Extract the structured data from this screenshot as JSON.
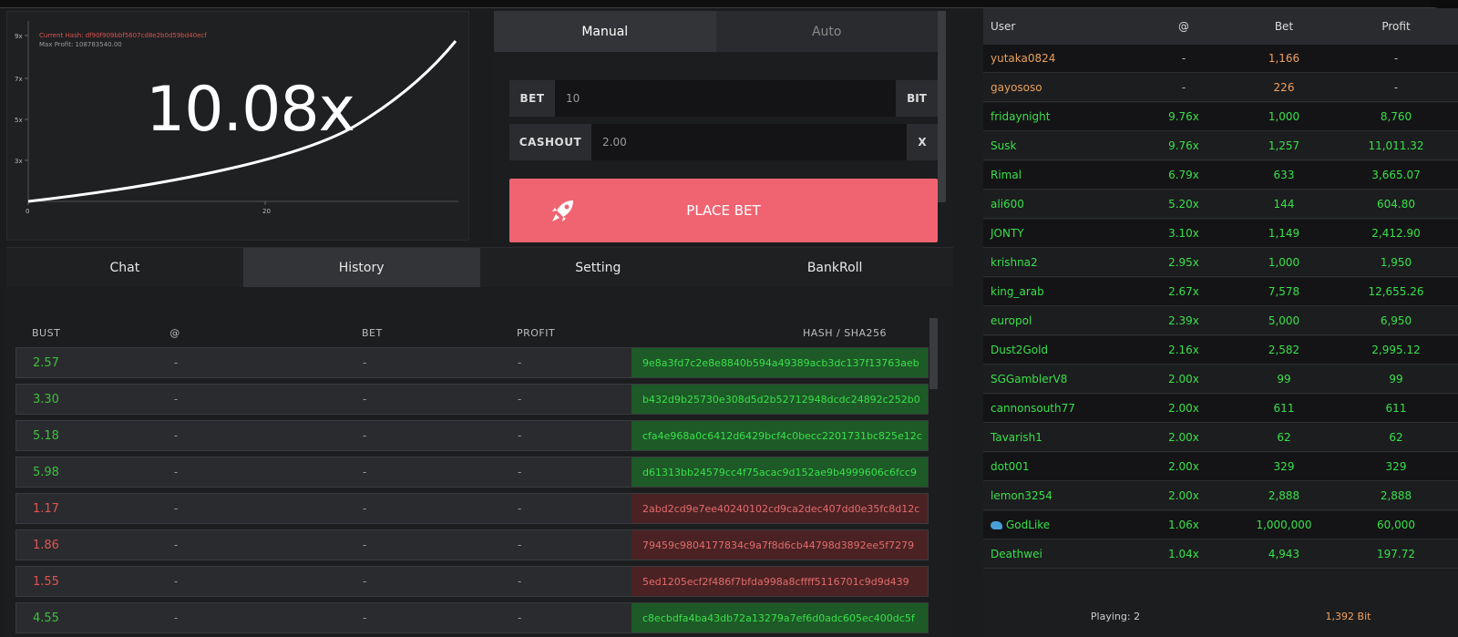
{
  "graph": {
    "current_hash": "Current Hash: df90f909bbf5607cd8e2b0d59bd40ecf",
    "max_profit": "Max Profit: 108783540.00",
    "multiplier": "10.08x",
    "y_ticks": [
      "9x",
      "7x",
      "5x",
      "3x"
    ],
    "x_ticks": [
      "0",
      "20"
    ]
  },
  "bet_panel": {
    "tabs": [
      "Manual",
      "Auto"
    ],
    "active_tab": "Manual",
    "bet_label": "BET",
    "bet_value": "10",
    "bet_unit": "BIT",
    "cashout_label": "CASHOUT",
    "cashout_value": "2.00",
    "cashout_unit": "X",
    "place_bet": "PLACE BET",
    "accent": "#f06472"
  },
  "bottom_tabs": [
    "Chat",
    "History",
    "Setting",
    "BankRoll"
  ],
  "active_bottom_tab": "History",
  "history": {
    "headers": [
      "BUST",
      "@",
      "BET",
      "PROFIT",
      "HASH / SHA256"
    ],
    "rows": [
      {
        "bust": "2.57",
        "at": "-",
        "bet": "-",
        "profit": "-",
        "hash": "9e8a3fd7c2e8e8840b594a49389acb3dc137f13763aeb",
        "status": "green"
      },
      {
        "bust": "3.30",
        "at": "-",
        "bet": "-",
        "profit": "-",
        "hash": "b432d9b25730e308d5d2b52712948dcdc24892c252b0",
        "status": "green"
      },
      {
        "bust": "5.18",
        "at": "-",
        "bet": "-",
        "profit": "-",
        "hash": "cfa4e968a0c6412d6429bcf4c0becc2201731bc825e12c",
        "status": "green"
      },
      {
        "bust": "5.98",
        "at": "-",
        "bet": "-",
        "profit": "-",
        "hash": "d61313bb24579cc4f75acac9d152ae9b4999606c6fcc9",
        "status": "green"
      },
      {
        "bust": "1.17",
        "at": "-",
        "bet": "-",
        "profit": "-",
        "hash": "2abd2cd9e7ee40240102cd9ca2dec407dd0e35fc8d12c",
        "status": "red"
      },
      {
        "bust": "1.86",
        "at": "-",
        "bet": "-",
        "profit": "-",
        "hash": "79459c9804177834c9a7f8d6cb44798d3892ee5f7279",
        "status": "red"
      },
      {
        "bust": "1.55",
        "at": "-",
        "bet": "-",
        "profit": "-",
        "hash": "5ed1205ecf2f486f7bfda998a8cffff5116701c9d9d439",
        "status": "red"
      },
      {
        "bust": "4.55",
        "at": "-",
        "bet": "-",
        "profit": "-",
        "hash": "c8ecbdfa4ba43db72a13279a7ef6d0adc605ec400dc5f",
        "status": "green"
      }
    ],
    "green": "#39e04a",
    "red": "#e36b6b"
  },
  "players": {
    "headers": [
      "User",
      "@",
      "Bet",
      "Profit"
    ],
    "rows": [
      {
        "user": "yutaka0824",
        "at": "-",
        "bet": "1,166",
        "profit": "-",
        "state": "pending"
      },
      {
        "user": "gayososo",
        "at": "-",
        "bet": "226",
        "profit": "-",
        "state": "pending"
      },
      {
        "user": "fridaynight",
        "at": "9.76x",
        "bet": "1,000",
        "profit": "8,760",
        "state": "won"
      },
      {
        "user": "Susk",
        "at": "9.76x",
        "bet": "1,257",
        "profit": "11,011.32",
        "state": "won"
      },
      {
        "user": "Rimal",
        "at": "6.79x",
        "bet": "633",
        "profit": "3,665.07",
        "state": "won"
      },
      {
        "user": "ali600",
        "at": "5.20x",
        "bet": "144",
        "profit": "604.80",
        "state": "won"
      },
      {
        "user": "JONTY",
        "at": "3.10x",
        "bet": "1,149",
        "profit": "2,412.90",
        "state": "won"
      },
      {
        "user": "krishna2",
        "at": "2.95x",
        "bet": "1,000",
        "profit": "1,950",
        "state": "won"
      },
      {
        "user": "king_arab",
        "at": "2.67x",
        "bet": "7,578",
        "profit": "12,655.26",
        "state": "won"
      },
      {
        "user": "europol",
        "at": "2.39x",
        "bet": "5,000",
        "profit": "6,950",
        "state": "won"
      },
      {
        "user": "Dust2Gold",
        "at": "2.16x",
        "bet": "2,582",
        "profit": "2,995.12",
        "state": "won"
      },
      {
        "user": "SGGamblerV8",
        "at": "2.00x",
        "bet": "99",
        "profit": "99",
        "state": "won"
      },
      {
        "user": "cannonsouth77",
        "at": "2.00x",
        "bet": "611",
        "profit": "611",
        "state": "won"
      },
      {
        "user": "Tavarish1",
        "at": "2.00x",
        "bet": "62",
        "profit": "62",
        "state": "won"
      },
      {
        "user": "dot001",
        "at": "2.00x",
        "bet": "329",
        "profit": "329",
        "state": "won"
      },
      {
        "user": "lemon3254",
        "at": "2.00x",
        "bet": "2,888",
        "profit": "2,888",
        "state": "won"
      },
      {
        "user": "GodLike",
        "at": "1.06x",
        "bet": "1,000,000",
        "profit": "60,000",
        "state": "won",
        "icon": "whale-icon"
      },
      {
        "user": "Deathwei",
        "at": "1.04x",
        "bet": "4,943",
        "profit": "197.72",
        "state": "won"
      }
    ],
    "playing": "Playing: 2",
    "total_bits": "1,392 Bit"
  }
}
